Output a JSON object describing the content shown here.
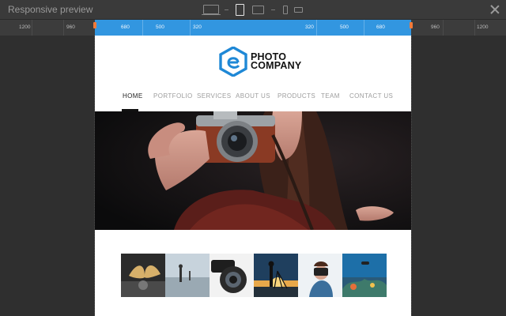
{
  "window": {
    "title": "Responsive preview"
  },
  "devices": [
    {
      "name": "desktop",
      "active": false
    },
    {
      "name": "tablet-portrait",
      "active": true
    },
    {
      "name": "tablet-landscape",
      "active": false
    },
    {
      "name": "phone-portrait",
      "active": false
    },
    {
      "name": "phone-landscape",
      "active": false
    }
  ],
  "ruler": {
    "left": [
      "1200",
      "960",
      "680",
      "500",
      "320"
    ],
    "right": [
      "320",
      "500",
      "680",
      "960",
      "1200"
    ]
  },
  "site": {
    "logo": {
      "line1": "PHOTO",
      "line2": "COMPANY",
      "color": "#1f88d6"
    },
    "nav": [
      "HOME",
      "PORTFOLIO",
      "SERVICES",
      "ABOUT US",
      "PRODUCTS",
      "TEAM",
      "CONTACT US"
    ],
    "active_nav": "HOME"
  },
  "gallery": [
    "butterfly",
    "beach-silhouette",
    "camera-lens",
    "sunset-photographer",
    "photographer-woman",
    "coral-reef"
  ]
}
